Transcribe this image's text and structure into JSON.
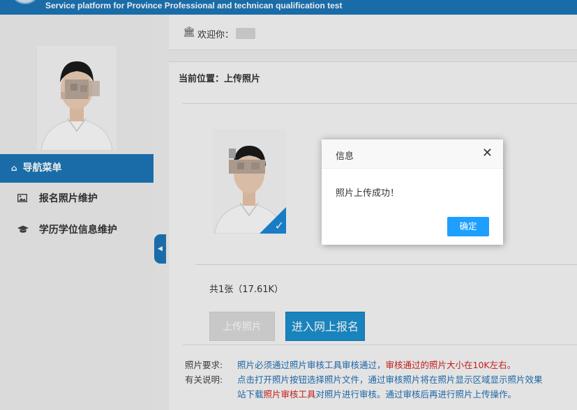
{
  "header": {
    "subtitle": "Service platform for Province Professional and technican qualification test"
  },
  "welcome": {
    "icon": "bank-icon",
    "text": "欢迎你："
  },
  "sidebar": {
    "nav_title": "导航菜单",
    "items": [
      {
        "label": "报名照片维护",
        "icon": "image-icon"
      },
      {
        "label": "学历学位信息维护",
        "icon": "graduation-cap-icon"
      }
    ]
  },
  "main": {
    "location": "当前位置：上传照片",
    "photo_count": "共1张（17.61K）",
    "upload_button": "上传照片",
    "enroll_button": "进入网上报名",
    "requirements_label": "照片要求:",
    "requirements_blue": "照片必须通过照片审核工具审核通过，",
    "requirements_red": "审核通过的照片大小在10K左右。",
    "notes_label": "有关说明:",
    "notes_line1": "点击打开照片按钮选择照片文件，通过审核照片将在照片显示区域显示照片效果",
    "notes_line2_a": "站下载",
    "notes_line2_red": "照片审核工具",
    "notes_line2_b": "对照片进行审核。通过审核后再进行照片上传操作。"
  },
  "dialog": {
    "title": "信息",
    "message": "照片上传成功！",
    "ok_label": "确定"
  },
  "colors": {
    "primary": "#1c76b7",
    "button_blue": "#1c8fce",
    "dialog_ok": "#1e9fff",
    "note_red": "#d42020",
    "note_blue": "#1f6fb3"
  }
}
